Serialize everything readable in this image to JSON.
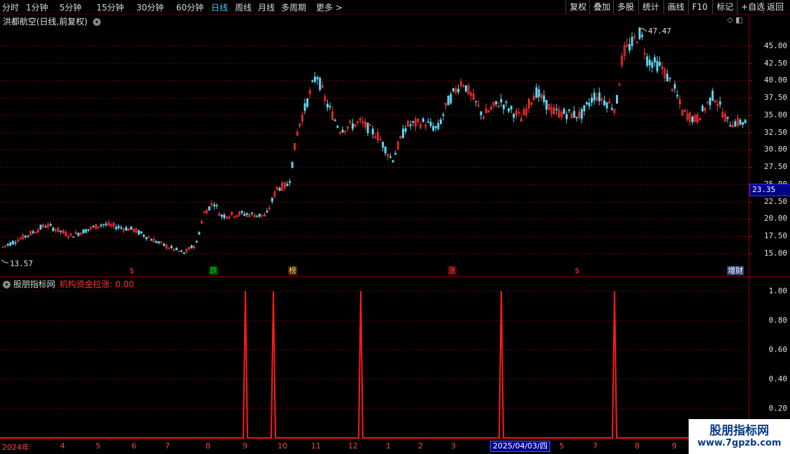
{
  "toolbar": {
    "periods": [
      "分时",
      "1分钟",
      "5分钟",
      "15分钟",
      "30分钟",
      "60分钟",
      "日线",
      "周线",
      "月线",
      "多周期",
      "更多 >"
    ],
    "active_period": "日线",
    "right_buttons": [
      "复权",
      "叠加",
      "多股",
      "统计",
      "画线",
      "F10",
      "标记",
      "+自选",
      "返回"
    ]
  },
  "chart": {
    "title": "洪都航空(日线,前复权)",
    "title_icon": "chevron-down-circle-icon",
    "corner_icons": "◇ ◧",
    "current_price": "23.35",
    "high_label": "47.47",
    "low_label": "13.57",
    "price_axis": [
      "45.00",
      "42.50",
      "40.00",
      "37.50",
      "35.00",
      "32.50",
      "30.00",
      "27.50",
      "25.00",
      "22.50",
      "20.00",
      "17.50",
      "15.00"
    ],
    "signals": [
      {
        "text": "$",
        "color": "#ff3030",
        "bg": "transparent"
      },
      {
        "text": "跌",
        "color": "#00e000",
        "bg": "#003000"
      },
      {
        "text": "榜",
        "color": "#ffcc66",
        "bg": "#402000"
      },
      {
        "text": "涨",
        "color": "#ff4040",
        "bg": "#400000"
      },
      {
        "text": "$",
        "color": "#ff3030",
        "bg": "transparent"
      },
      {
        "text": "增财",
        "color": "#ffffff",
        "bg": "#304080"
      }
    ]
  },
  "indicator": {
    "name": "股朋指标网",
    "value_label": "机构资金拉涨: 0.00",
    "axis": [
      "1.00",
      "0.80",
      "0.60",
      "0.40",
      "0.20"
    ],
    "pulse_positions_note": "",
    "pulses": [
      1,
      1,
      1,
      1,
      1
    ]
  },
  "time_axis": {
    "labels": [
      "2024年",
      "4",
      "5",
      "6",
      "7",
      "8",
      "9",
      "10",
      "11",
      "12",
      "1",
      "2",
      "3",
      "4",
      "5",
      "6",
      "7",
      "8",
      "9"
    ],
    "tooltip": "2025/04/03/四"
  },
  "watermark": {
    "line1": "股朋指标网",
    "line2": "www.7gpzb.com"
  },
  "colors": {
    "up": "#ff3030",
    "down": "#5ed6f0",
    "grid": "#7a0000",
    "indicator_line": "#ff1a1a",
    "axis_bg": "#00008b"
  }
}
